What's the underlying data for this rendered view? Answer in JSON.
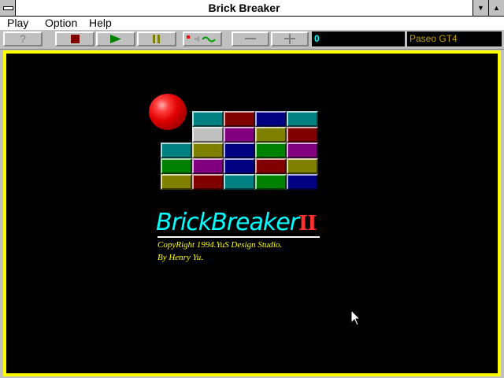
{
  "window": {
    "title": "Brick Breaker",
    "minimize_glyph": "▼",
    "maximize_glyph": "▲"
  },
  "menu": [
    "Play",
    "Option",
    "Help"
  ],
  "toolbar": {
    "help_glyph": "?",
    "score": "0",
    "player": "Paseo GT4",
    "buttons": [
      "help-icon",
      "stop-icon",
      "play-icon",
      "pause-icon",
      "sound-icon",
      "minus-icon",
      "plus-icon"
    ]
  },
  "splash": {
    "logo_main": "BrickBreaker",
    "logo_roman": "II",
    "copyright": "CopyRight 1994.YuS Design Studio.",
    "author": "By Henry Yu."
  },
  "colors": {
    "accent_border": "#ffff00",
    "logo": "#00ffff",
    "credit": "#ffff00"
  },
  "bricks": [
    [
      "",
      "",
      "teal",
      "red",
      "blue",
      "teal"
    ],
    [
      "",
      "",
      "silver",
      "purple",
      "olive",
      "red"
    ],
    [
      "",
      "teal",
      "olive",
      "blue",
      "green",
      "purple"
    ],
    [
      "",
      "green",
      "purple",
      "blue",
      "red",
      "olive"
    ],
    [
      "",
      "olive",
      "red",
      "teal",
      "green",
      "blue"
    ]
  ]
}
